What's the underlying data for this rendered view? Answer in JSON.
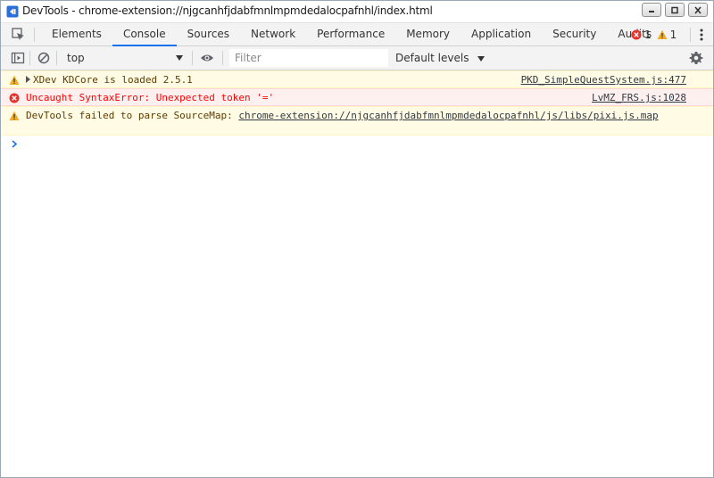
{
  "window": {
    "title": "DevTools - chrome-extension://njgcanhfjdabfmnlmpmdedalocpafnhl/index.html",
    "icon": "devtools-app-icon",
    "controls": [
      "minimize-icon",
      "restore-icon",
      "close-icon"
    ]
  },
  "tabs": {
    "items": [
      {
        "label": "Elements"
      },
      {
        "label": "Console",
        "active": true
      },
      {
        "label": "Sources"
      },
      {
        "label": "Network"
      },
      {
        "label": "Performance"
      },
      {
        "label": "Memory"
      },
      {
        "label": "Application"
      },
      {
        "label": "Security"
      },
      {
        "label": "Audits"
      }
    ],
    "error_count": "1",
    "warning_count": "1"
  },
  "toolbar": {
    "context": "top",
    "filter_placeholder": "Filter",
    "levels_label": "Default levels"
  },
  "messages": [
    {
      "level": "warning",
      "text": "XDev KDCore is loaded 2.5.1",
      "source": "PKD_SimpleQuestSystem.js:477",
      "expandable": true
    },
    {
      "level": "error",
      "text": "Uncaught SyntaxError: Unexpected token '='",
      "source": "LvMZ_FRS.js:1028"
    },
    {
      "level": "warning",
      "text": "DevTools failed to parse SourceMap: ",
      "link": "chrome-extension://njgcanhfjdabfmnlmpmdedalocpafnhl/js/libs/pixi.js.map"
    }
  ],
  "colors": {
    "accent": "#1a73e8",
    "warning_bg": "#fffbe5",
    "error_bg": "#fff0f0",
    "error_text": "#ff0000",
    "warning_icon": "#f2ab26",
    "error_icon": "#e3342f"
  }
}
